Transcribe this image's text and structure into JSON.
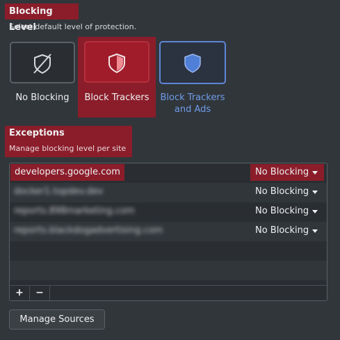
{
  "blocking_level": {
    "title": "Blocking Level",
    "subtitle": "Select default level of protection.",
    "options": [
      {
        "label": "No Blocking",
        "selected": false
      },
      {
        "label": "Block Trackers",
        "selected": true
      },
      {
        "label": "Block Trackers and Ads",
        "label_line1": "Block Trackers",
        "label_line2": "and Ads",
        "selected": false
      }
    ]
  },
  "exceptions": {
    "title": "Exceptions",
    "subtitle": "Manage blocking level per site",
    "rows": [
      {
        "site": "developers.google.com",
        "level": "No Blocking"
      },
      {
        "site": "docker1.topdev.dev",
        "level": "No Blocking"
      },
      {
        "site": "reports.898marketing.com",
        "level": "No Blocking"
      },
      {
        "site": "reports.blackdogadvertising.com",
        "level": "No Blocking"
      }
    ],
    "add_label": "+",
    "remove_label": "−"
  },
  "manage_sources_label": "Manage Sources",
  "colors": {
    "background": "#31363b",
    "highlight": "#8b1d2a",
    "selected_option": "#a01c2a",
    "ads_accent": "#5f86d6"
  }
}
